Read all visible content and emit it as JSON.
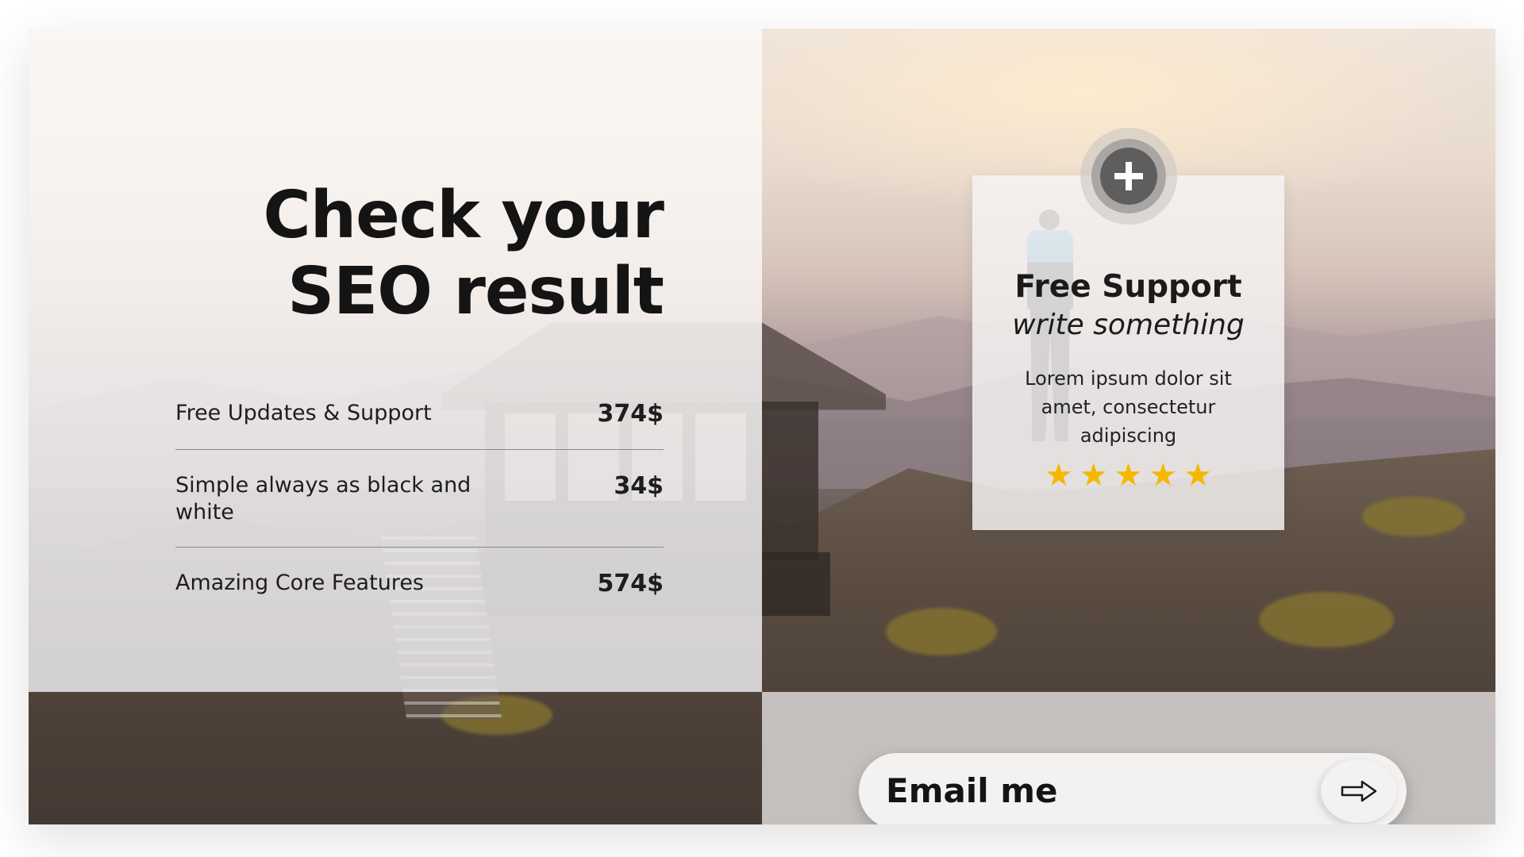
{
  "slide": {
    "title_line1": "Check your",
    "title_line2": "SEO result",
    "features": [
      {
        "name": "Free Updates & Support",
        "price": "374$"
      },
      {
        "name": "Simple always as black and white",
        "price": "34$"
      },
      {
        "name": "Amazing Core Features",
        "price": "574$"
      }
    ]
  },
  "card": {
    "icon": "plus-icon",
    "title": "Free Support",
    "subtitle": "write something",
    "text": "Lorem ipsum dolor sit amet, consectetur adipiscing",
    "rating": 5,
    "star_color": "#f5b800"
  },
  "email": {
    "label": "Email me",
    "icon": "arrow-right-icon"
  }
}
